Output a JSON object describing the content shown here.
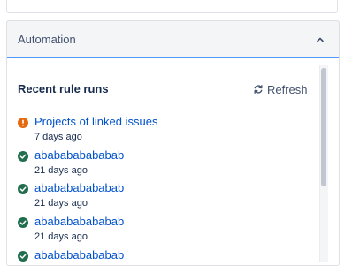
{
  "panel": {
    "title": "Automation",
    "section_title": "Recent rule runs",
    "refresh_label": "Refresh"
  },
  "runs": [
    {
      "status": "warning",
      "name": "Projects of linked issues",
      "time": "7 days ago"
    },
    {
      "status": "success",
      "name": "ababababababab",
      "time": "21 days ago"
    },
    {
      "status": "success",
      "name": "ababababababab",
      "time": "21 days ago"
    },
    {
      "status": "success",
      "name": "ababababababab",
      "time": "21 days ago"
    },
    {
      "status": "success",
      "name": "ababababababab",
      "time": ""
    }
  ],
  "colors": {
    "link": "#0052cc",
    "success": "#216e4e",
    "warning": "#e56910",
    "header_bg": "#f4f5f7",
    "header_border": "#4c9aff"
  },
  "icons": {
    "collapse": "chevron-up-icon",
    "refresh": "refresh-icon",
    "success": "check-circle-icon",
    "warning": "warning-circle-icon"
  }
}
